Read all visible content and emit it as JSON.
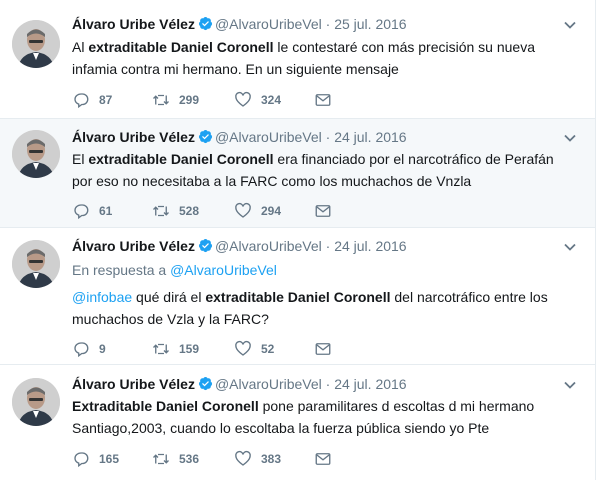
{
  "colors": {
    "link": "#1da1f2",
    "muted": "#657786",
    "text": "#14171a",
    "highlight_bg": "#f5f8fa",
    "border": "#e6ecf0"
  },
  "icons": [
    "avatar",
    "verified-badge-icon",
    "chevron-down-icon",
    "reply-icon",
    "retweet-icon",
    "like-icon",
    "dm-envelope-icon"
  ],
  "tweets": [
    {
      "name": "Álvaro Uribe Vélez",
      "handle": "@AlvaroUribeVel",
      "sep": "·",
      "date": "25 jul. 2016",
      "text_pre": "Al ",
      "text_bold": "extraditable Daniel Coronell",
      "text_post": " le contestaré con más precisión su nueva infamia contra mi hermano. En un siguiente mensaje",
      "replies": "87",
      "retweets": "299",
      "likes": "324"
    },
    {
      "name": "Álvaro Uribe Vélez",
      "handle": "@AlvaroUribeVel",
      "sep": "·",
      "date": "24 jul. 2016",
      "text_pre": "El ",
      "text_bold": "extraditable Daniel Coronell",
      "text_post": " era financiado por el narcotráfico de Perafán por eso no necesitaba a la FARC como los muchachos de Vnzla",
      "replies": "61",
      "retweets": "528",
      "likes": "294"
    },
    {
      "name": "Álvaro Uribe Vélez",
      "handle": "@AlvaroUribeVel",
      "sep": "·",
      "date": "24 jul. 2016",
      "reply_prefix": "En respuesta a ",
      "reply_target": "@AlvaroUribeVel",
      "mention": "@infobae",
      "text_pre": " qué dirá el ",
      "text_bold": "extraditable Daniel Coronell",
      "text_post": " del narcotráfico entre los muchachos de Vzla y la FARC?",
      "replies": "9",
      "retweets": "159",
      "likes": "52"
    },
    {
      "name": "Álvaro Uribe Vélez",
      "handle": "@AlvaroUribeVel",
      "sep": "·",
      "date": "24 jul. 2016",
      "text_pre": "",
      "text_bold": "Extraditable Daniel Coronell",
      "text_post": " pone paramilitares d escoltas d mi hermano Santiago,2003, cuando lo escoltaba la fuerza pública siendo yo Pte",
      "replies": "165",
      "retweets": "536",
      "likes": "383"
    }
  ]
}
